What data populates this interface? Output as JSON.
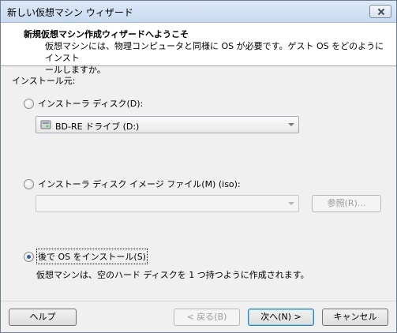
{
  "window": {
    "title": "新しい仮想マシン ウィザード"
  },
  "header": {
    "heading": "新規仮想マシン作成ウィザードへようこそ",
    "description_line1": "仮想マシンには、物理コンピュータと同様に OS が必要です。ゲスト OS をどのようにインスト",
    "description_line2": "ールしますか。"
  },
  "source_label": "インストール元:",
  "options": {
    "disc": {
      "label": "インストーラ ディスク(D):",
      "selected": false,
      "value": "BD-RE ドライブ (D:)"
    },
    "iso": {
      "label": "インストーラ ディスク イメージ ファイル(M) (iso):",
      "selected": false,
      "value": "",
      "browse_label": "参照(R)..."
    },
    "later": {
      "label": "後で OS をインストール(S)",
      "selected": true,
      "info": "仮想マシンは、空のハード ディスクを 1 つ持つように作成されます。"
    }
  },
  "buttons": {
    "help": "ヘルプ",
    "back": "< 戻る(B)",
    "next": "次へ(N) >",
    "cancel": "キャンセル"
  },
  "icons": {
    "close": "close-icon",
    "drive": "optical-drive-icon"
  }
}
